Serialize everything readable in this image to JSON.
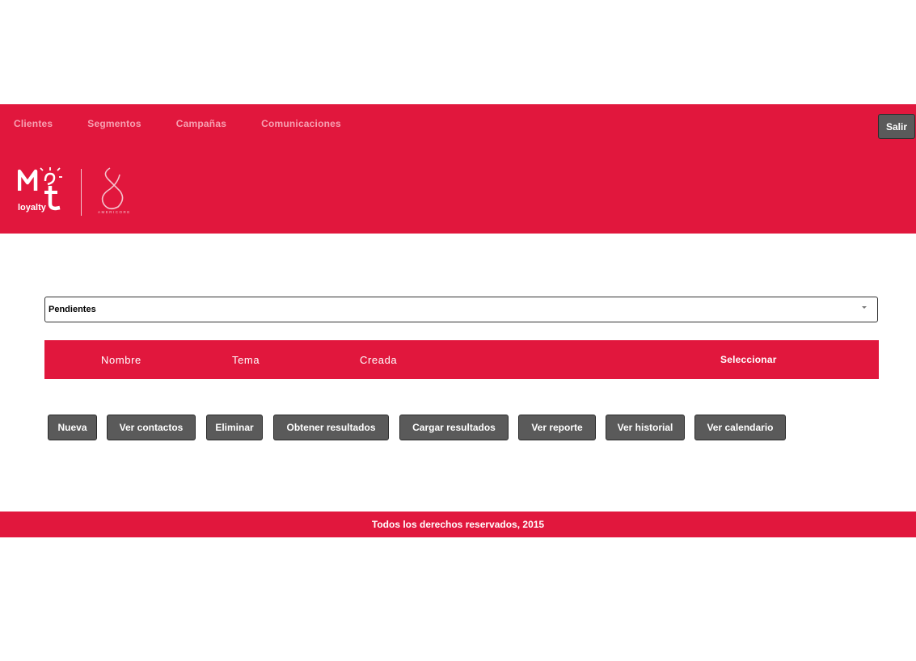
{
  "nav": {
    "items": [
      "Clientes",
      "Segmentos",
      "Campañas",
      "Comunicaciones"
    ],
    "logout_label": "Salir"
  },
  "logo": {
    "brand_text": "loyalty",
    "partner_text": "AMERICORE"
  },
  "filter": {
    "selected": "Pendientes"
  },
  "table": {
    "columns": [
      "Nombre",
      "Tema",
      "Creada",
      "Seleccionar"
    ]
  },
  "actions": [
    "Nueva",
    "Ver contactos",
    "Eliminar",
    "Obtener resultados",
    "Cargar resultados",
    "Ver reporte",
    "Ver historial",
    "Ver calendario"
  ],
  "footer": {
    "text": "Todos los derechos reservados, 2015"
  },
  "colors": {
    "brand": "#e1173d",
    "button": "#5a5a5a"
  }
}
